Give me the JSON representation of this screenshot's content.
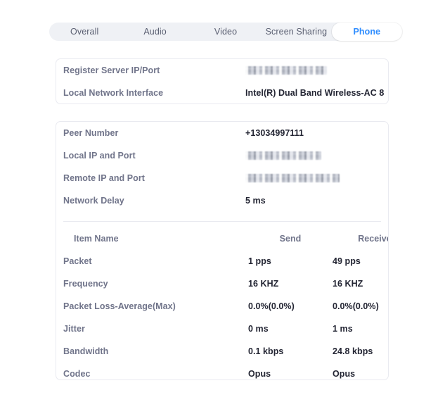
{
  "tabs": [
    {
      "label": "Overall",
      "active": false
    },
    {
      "label": "Audio",
      "active": false
    },
    {
      "label": "Video",
      "active": false
    },
    {
      "label": "Screen Sharing",
      "active": false
    },
    {
      "label": "Phone",
      "active": true
    }
  ],
  "register_card": {
    "rows": [
      {
        "label": "Register Server IP/Port",
        "value": "",
        "redacted": true
      },
      {
        "label": "Local Network Interface",
        "value": "Intel(R) Dual Band Wireless-AC 8",
        "redacted": false
      }
    ]
  },
  "peer_card": {
    "rows": [
      {
        "label": "Peer Number",
        "value": "+13034997111",
        "redacted": false
      },
      {
        "label": "Local IP and Port",
        "value": "",
        "redacted": true
      },
      {
        "label": "Remote IP and Port",
        "value": "",
        "redacted": true
      },
      {
        "label": "Network Delay",
        "value": "5 ms",
        "redacted": false
      }
    ],
    "table": {
      "headers": [
        "Item Name",
        "Send",
        "Receive"
      ],
      "rows": [
        {
          "name": "Packet",
          "send": "1 pps",
          "receive": "49 pps"
        },
        {
          "name": "Frequency",
          "send": "16 KHZ",
          "receive": "16 KHZ"
        },
        {
          "name": "Packet Loss-Average(Max)",
          "send": "0.0%(0.0%)",
          "receive": "0.0%(0.0%)"
        },
        {
          "name": "Jitter",
          "send": "0 ms",
          "receive": "1 ms"
        },
        {
          "name": "Bandwidth",
          "send": "0.1 kbps",
          "receive": "24.8 kbps"
        },
        {
          "name": "Codec",
          "send": "Opus",
          "receive": "Opus"
        }
      ]
    }
  },
  "colors": {
    "accent": "#2d8cff",
    "label": "#70748a",
    "value": "#232533",
    "tabbar_bg": "#eff1f5",
    "card_border": "#e9eaf0"
  }
}
